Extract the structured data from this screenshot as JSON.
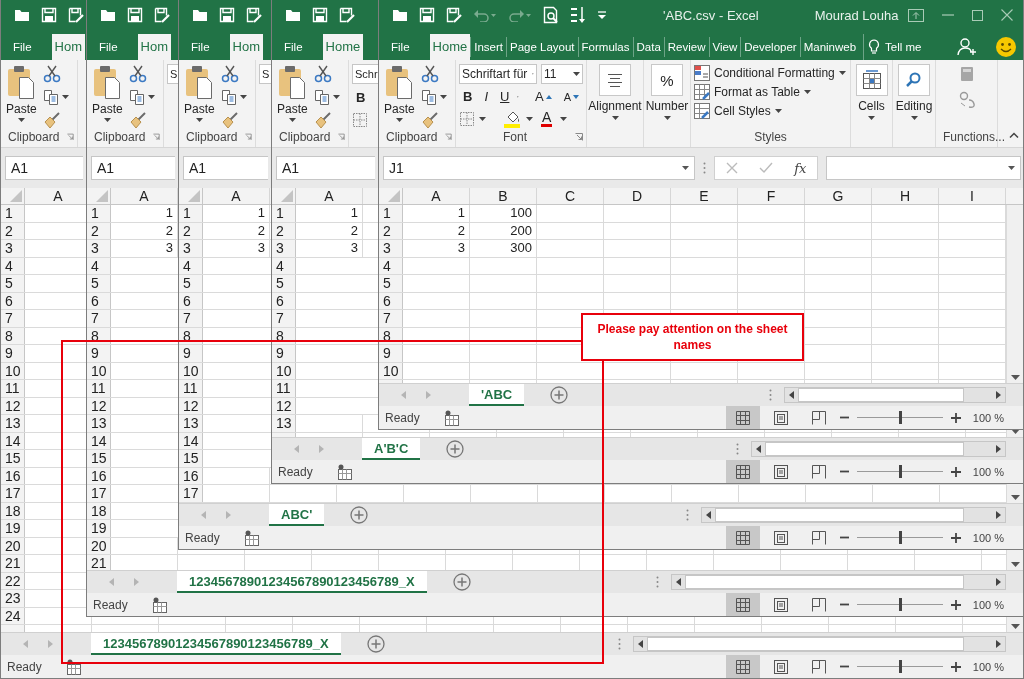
{
  "windows": [
    {
      "tabs": [
        {
          "label": "File",
          "selected": false
        },
        {
          "label": "Hom",
          "selected": true
        }
      ],
      "ribbon": [
        {
          "kind": "clipboard",
          "paste": "Paste",
          "label": "Clipboard"
        }
      ],
      "name_box": "A1",
      "columns": [
        "A"
      ],
      "rows": [
        {
          "header": "1"
        },
        {
          "header": "2"
        },
        {
          "header": "3"
        },
        {
          "header": "4"
        },
        {
          "header": "5"
        },
        {
          "header": "6"
        },
        {
          "header": "7"
        },
        {
          "header": "8"
        },
        {
          "header": "9"
        },
        {
          "header": "10"
        },
        {
          "header": "11"
        },
        {
          "header": "12"
        },
        {
          "header": "13"
        },
        {
          "header": "14"
        },
        {
          "header": "15"
        },
        {
          "header": "16"
        },
        {
          "header": "17"
        },
        {
          "header": "18"
        },
        {
          "header": "19"
        },
        {
          "header": "20"
        },
        {
          "header": "21"
        },
        {
          "header": "22"
        },
        {
          "header": "23"
        },
        {
          "header": "24"
        }
      ],
      "sheet_tabs": [
        {
          "label": "12345678901234567890123456789_X",
          "selected": true
        }
      ],
      "status": "Ready",
      "views": [
        {
          "selected": true
        },
        {
          "selected": false
        },
        {
          "selected": false
        }
      ],
      "zoom": {
        "level": 0.5,
        "reading": "100 %"
      }
    },
    {
      "tabs": [
        {
          "label": "File",
          "selected": false
        },
        {
          "label": "Hom",
          "selected": true
        }
      ],
      "ribbon": [
        {
          "kind": "clipboard",
          "paste": "Paste",
          "label": "Clipboard"
        },
        {
          "kind": "font",
          "font": "S"
        }
      ],
      "name_box": "A1",
      "columns": [
        "A"
      ],
      "rows": [
        {
          "header": "1",
          "cells": [
            "1"
          ]
        },
        {
          "header": "2",
          "cells": [
            "2"
          ]
        },
        {
          "header": "3",
          "cells": [
            "3"
          ]
        },
        {
          "header": "4"
        },
        {
          "header": "5"
        },
        {
          "header": "6"
        },
        {
          "header": "7"
        },
        {
          "header": "8"
        },
        {
          "header": "9"
        },
        {
          "header": "10"
        },
        {
          "header": "11"
        },
        {
          "header": "12"
        },
        {
          "header": "13"
        },
        {
          "header": "14"
        },
        {
          "header": "15"
        },
        {
          "header": "16"
        },
        {
          "header": "17"
        },
        {
          "header": "18"
        },
        {
          "header": "19"
        },
        {
          "header": "20"
        },
        {
          "header": "21"
        }
      ],
      "sheet_tabs": [
        {
          "label": "12345678901234567890123456789_X",
          "selected": true
        }
      ],
      "status": "Ready",
      "views": [
        {
          "selected": true
        },
        {
          "selected": false
        },
        {
          "selected": false
        }
      ],
      "zoom": {
        "level": 0.5,
        "reading": "100 %"
      }
    },
    {
      "tabs": [
        {
          "label": "File",
          "selected": false
        },
        {
          "label": "Hom",
          "selected": true
        }
      ],
      "ribbon": [
        {
          "kind": "clipboard",
          "paste": "Paste",
          "label": "Clipboard"
        },
        {
          "kind": "font",
          "font": "S"
        }
      ],
      "name_box": "A1",
      "columns": [
        "A"
      ],
      "rows": [
        {
          "header": "1",
          "cells": [
            "1"
          ]
        },
        {
          "header": "2",
          "cells": [
            "2"
          ]
        },
        {
          "header": "3",
          "cells": [
            "3"
          ]
        },
        {
          "header": "4"
        },
        {
          "header": "5"
        },
        {
          "header": "6"
        },
        {
          "header": "7"
        },
        {
          "header": "8"
        },
        {
          "header": "9"
        },
        {
          "header": "10"
        },
        {
          "header": "11"
        },
        {
          "header": "12"
        },
        {
          "header": "13"
        },
        {
          "header": "14"
        },
        {
          "header": "15"
        },
        {
          "header": "16"
        },
        {
          "header": "17"
        }
      ],
      "sheet_tabs": [
        {
          "label": "ABC'",
          "selected": true
        }
      ],
      "status": "Ready",
      "views": [
        {
          "selected": true
        },
        {
          "selected": false
        },
        {
          "selected": false
        }
      ],
      "zoom": {
        "level": 0.5,
        "reading": "100 %"
      }
    },
    {
      "tabs": [
        {
          "label": "File",
          "selected": false
        },
        {
          "label": "Home",
          "selected": true
        }
      ],
      "ribbon": [
        {
          "kind": "clipboard",
          "paste": "Paste",
          "label": "Clipboard"
        },
        {
          "kind": "font",
          "font": "Schr",
          "bold": "B"
        }
      ],
      "name_box": "A1",
      "columns": [
        "A"
      ],
      "rows": [
        {
          "header": "1",
          "cells": [
            "1"
          ]
        },
        {
          "header": "2",
          "cells": [
            "2"
          ]
        },
        {
          "header": "3",
          "cells": [
            "3"
          ]
        },
        {
          "header": "4"
        },
        {
          "header": "5"
        },
        {
          "header": "6"
        },
        {
          "header": "7"
        },
        {
          "header": "8"
        },
        {
          "header": "9"
        },
        {
          "header": "10"
        },
        {
          "header": "11"
        },
        {
          "header": "12"
        },
        {
          "header": "13"
        }
      ],
      "sheet_tabs": [
        {
          "label": "A'B'C",
          "selected": true
        }
      ],
      "status": "Ready",
      "views": [
        {
          "selected": true
        },
        {
          "selected": false
        },
        {
          "selected": false
        }
      ],
      "zoom": {
        "level": 0.5,
        "reading": "100 %"
      }
    },
    {
      "title": "'ABC.csv  -  Excel",
      "user": "Mourad Louha",
      "tabs": [
        {
          "label": "File",
          "selected": false
        },
        {
          "label": "Home",
          "selected": true
        },
        {
          "label": "Insert",
          "selected": false
        },
        {
          "label": "Page Layout",
          "selected": false
        },
        {
          "label": "Formulas",
          "selected": false
        },
        {
          "label": "Data",
          "selected": false
        },
        {
          "label": "Review",
          "selected": false
        },
        {
          "label": "View",
          "selected": false
        },
        {
          "label": "Developer",
          "selected": false
        },
        {
          "label": "Maninweb",
          "selected": false
        }
      ],
      "tell_me": "Tell me",
      "ribbon": [
        {
          "kind": "clipboard",
          "paste": "Paste",
          "label": "Clipboard"
        },
        {
          "kind": "font",
          "font": "Schriftart für",
          "size": "11",
          "bold": "B",
          "italic": "I",
          "underline": "U",
          "grow": "A",
          "shrink": "A",
          "font_color": "A",
          "label": "Font"
        },
        {
          "kind": "alignment",
          "label": "Alignment"
        },
        {
          "kind": "number",
          "symbol": "%",
          "label": "Number"
        },
        {
          "kind": "styles",
          "items": [
            "Conditional Formatting",
            "Format as Table",
            "Cell Styles"
          ],
          "label": "Styles"
        },
        {
          "kind": "cells",
          "label": "Cells"
        },
        {
          "kind": "editing",
          "label": "Editing"
        },
        {
          "kind": "functions",
          "label": "Functions..."
        }
      ],
      "name_box": "J1",
      "formula_bar": {
        "function_button": "fx"
      },
      "columns": [
        "A",
        "B",
        "C",
        "D",
        "E",
        "F",
        "G",
        "H",
        "I"
      ],
      "rows": [
        {
          "header": "1",
          "cells": [
            "1",
            "100"
          ]
        },
        {
          "header": "2",
          "cells": [
            "2",
            "200"
          ]
        },
        {
          "header": "3",
          "cells": [
            "3",
            "300"
          ]
        },
        {
          "header": "4"
        },
        {
          "header": "5"
        },
        {
          "header": "6"
        },
        {
          "header": "7"
        },
        {
          "header": "8"
        },
        {
          "header": "9"
        },
        {
          "header": "10"
        }
      ],
      "sheet_tabs": [
        {
          "label": "'ABC",
          "selected": true
        }
      ],
      "status": "Ready",
      "views": [
        {
          "selected": true
        },
        {
          "selected": false
        },
        {
          "selected": false
        }
      ],
      "zoom": {
        "level": 0.5,
        "reading": "100 %"
      }
    }
  ],
  "callout": {
    "text": "Please pay attention on the sheet names"
  }
}
